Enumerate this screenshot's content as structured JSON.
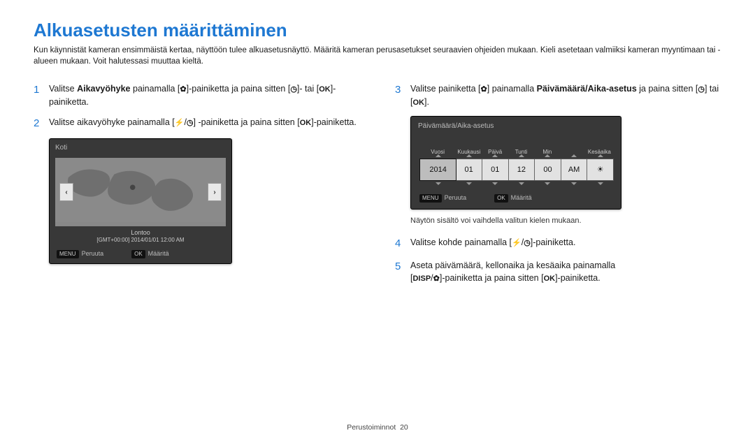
{
  "title": "Alkuasetusten määrittäminen",
  "intro": "Kun käynnistät kameran ensimmäistä kertaa, näyttöön tulee alkuasetusnäyttö. Määritä kameran perusasetukset seuraavien ohjeiden mukaan. Kieli asetetaan valmiiksi kameran myyntimaan tai -alueen mukaan. Voit halutessasi muuttaa kieltä.",
  "steps": {
    "1": {
      "pre": "Valitse ",
      "bold": "Aikavyöhyke",
      "post1": " painamalla [",
      "post2": "]-painiketta ja paina sitten [",
      "post3": "]- tai [",
      "post4": "]-painiketta."
    },
    "2": {
      "pre": "Valitse aikavyöhyke painamalla [",
      "mid": "] -painiketta ja paina sitten [",
      "post": "]-painiketta."
    },
    "3": {
      "pre": "Valitse painiketta [",
      "mid1": "] painamalla ",
      "bold": "Päivämäärä/Aika-asetus",
      "mid2": " ja paina sitten [",
      "mid3": "] tai [",
      "post": "]."
    },
    "4": {
      "pre": "Valitse kohde painamalla [",
      "post": "]-painiketta."
    },
    "5": {
      "line1a": "Aseta päivämäärä, kellonaika ja kesäaika painamalla ",
      "line2a": "[",
      "line2b": "]-painiketta ja paina sitten [",
      "line2c": "]-painiketta."
    }
  },
  "lcd_map": {
    "title": "Koti",
    "city": "Lontoo",
    "tz": "[GMT+00:00] 2014/01/01 12:00 AM",
    "menu_btn": "MENU",
    "ok_btn": "OK",
    "cancel": "Peruuta",
    "set": "Määritä"
  },
  "lcd_date": {
    "title": "Päivämäärä/Aika-asetus",
    "labels": [
      "Vuosi",
      "Kuukausi",
      "Päivä",
      "Tunti",
      "Min",
      "",
      "Kesäaika"
    ],
    "values": [
      "2014",
      "01",
      "01",
      "12",
      "00",
      "AM",
      "☀"
    ],
    "menu_btn": "MENU",
    "ok_btn": "OK",
    "cancel": "Peruuta",
    "set": "Määritä"
  },
  "note": "Näytön sisältö voi vaihdella valitun kielen mukaan.",
  "footer": {
    "section": "Perustoiminnot",
    "page": "20"
  },
  "icons": {
    "macro": "✿",
    "timer": "◷",
    "ok": "OK",
    "flash": "⚡",
    "disp": "DISP"
  }
}
